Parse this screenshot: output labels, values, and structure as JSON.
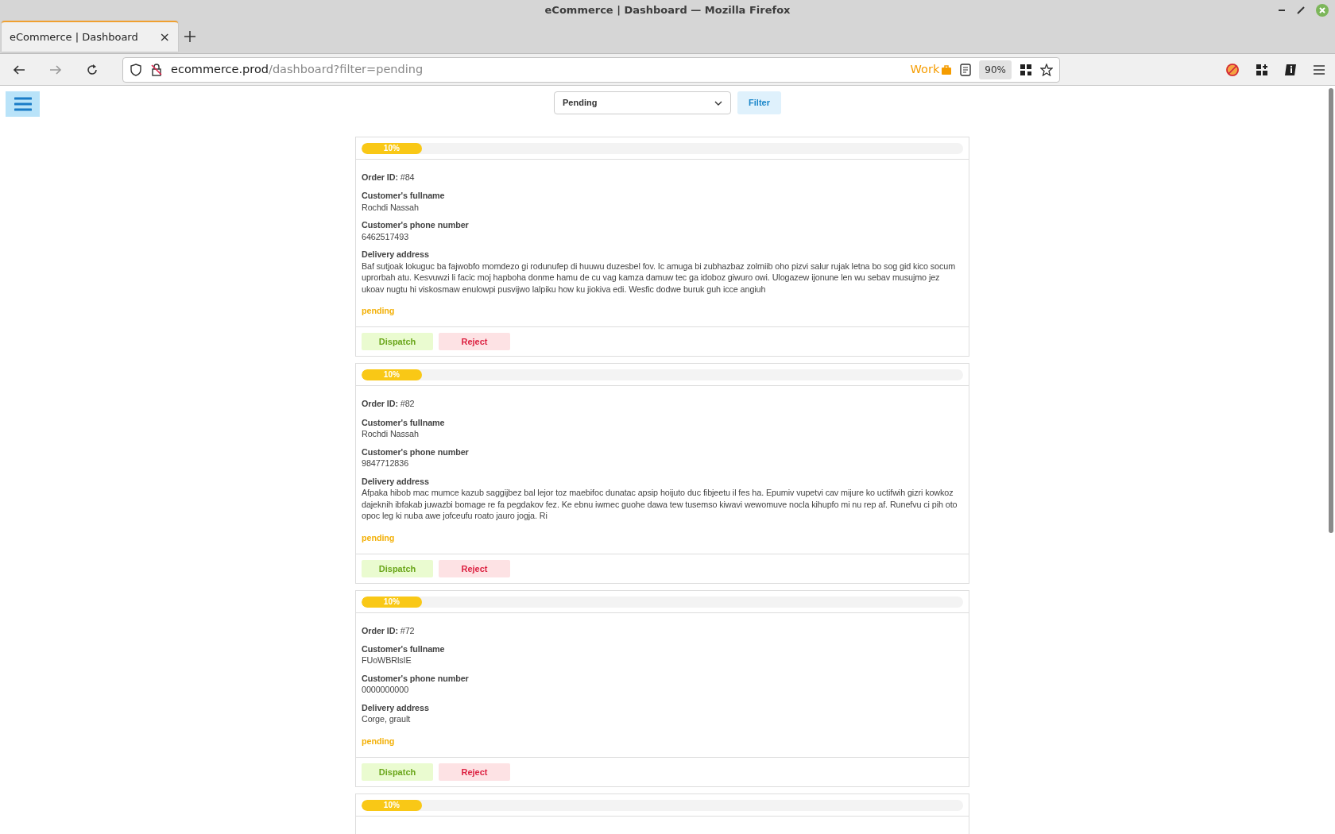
{
  "window": {
    "title": "eCommerce | Dashboard — Mozilla Firefox"
  },
  "tabs": [
    {
      "label": "eCommerce | Dashboard",
      "selected": true,
      "close": "×"
    }
  ],
  "address_bar": {
    "host": "ecommerce.prod",
    "path": "/dashboard?filter=pending",
    "container": "Work",
    "zoom": "90%"
  },
  "filter": {
    "value": "Pending",
    "button": "Filter"
  },
  "orders": [
    {
      "progress_label": "10%",
      "level": 0.1,
      "id_label": "Order ID:",
      "id": "#84",
      "fields": [
        {
          "label": "Customer's fullname",
          "value": "Rochdi Nassah"
        },
        {
          "label": "Customer's phone number",
          "value": "6462517493"
        },
        {
          "label": "Delivery address",
          "value": "Baf sutjoak lokuguc ba fajwobfo momdezo gi rodunufep di huuwu duzesbel fov. Ic amuga bi zubhazbaz zolmiib oho pizvi salur rujak letna bo sog gid kico socum uprorbah atu. Kesvuwzi li facic moj hapboha donme hamu de cu vag kamza damuw tec ga idoboz giwuro owi. Ulogazew ijonune len wu sebav musujmo jez ukoav nugtu hi viskosmaw enulowpi pusvijwo lalpiku how ku jiokiva edi. Wesfic dodwe buruk guh icce angiuh"
        }
      ],
      "status": "pending",
      "actions": [
        {
          "kind": "dispatch",
          "label": "Dispatch"
        },
        {
          "kind": "reject",
          "label": "Reject"
        }
      ]
    },
    {
      "progress_label": "10%",
      "level": 0.1,
      "id_label": "Order ID:",
      "id": "#82",
      "fields": [
        {
          "label": "Customer's fullname",
          "value": "Rochdi Nassah"
        },
        {
          "label": "Customer's phone number",
          "value": "9847712836"
        },
        {
          "label": "Delivery address",
          "value": "Afpaka hibob mac mumce kazub saggijbez bal lejor toz maebifoc dunatac apsip hoijuto duc fibjeetu il fes ha. Epumiv vupetvi cav mijure ko uctifwih gizri kowkoz dajeknih ibfakab juwazbi bomage re fa pegdakov fez. Ke ebnu iwmec guohe dawa tew tusemso kiwavi wewomuve nocla kihupfo mi nu rep af. Runefvu ci pih oto opoc leg ki nuba awe jofceufu roato jauro jogja. Ri"
        }
      ],
      "status": "pending",
      "actions": [
        {
          "kind": "dispatch",
          "label": "Dispatch"
        },
        {
          "kind": "reject",
          "label": "Reject"
        }
      ]
    },
    {
      "progress_label": "10%",
      "level": 0.1,
      "id_label": "Order ID:",
      "id": "#72",
      "fields": [
        {
          "label": "Customer's fullname",
          "value": "FUoWBRlsIE"
        },
        {
          "label": "Customer's phone number",
          "value": "0000000000"
        },
        {
          "label": "Delivery address",
          "value": "Corge, grault"
        }
      ],
      "status": "pending",
      "actions": [
        {
          "kind": "dispatch",
          "label": "Dispatch"
        },
        {
          "kind": "reject",
          "label": "Reject"
        }
      ]
    },
    {
      "progress_label": "10%",
      "level": 0.1
    }
  ]
}
